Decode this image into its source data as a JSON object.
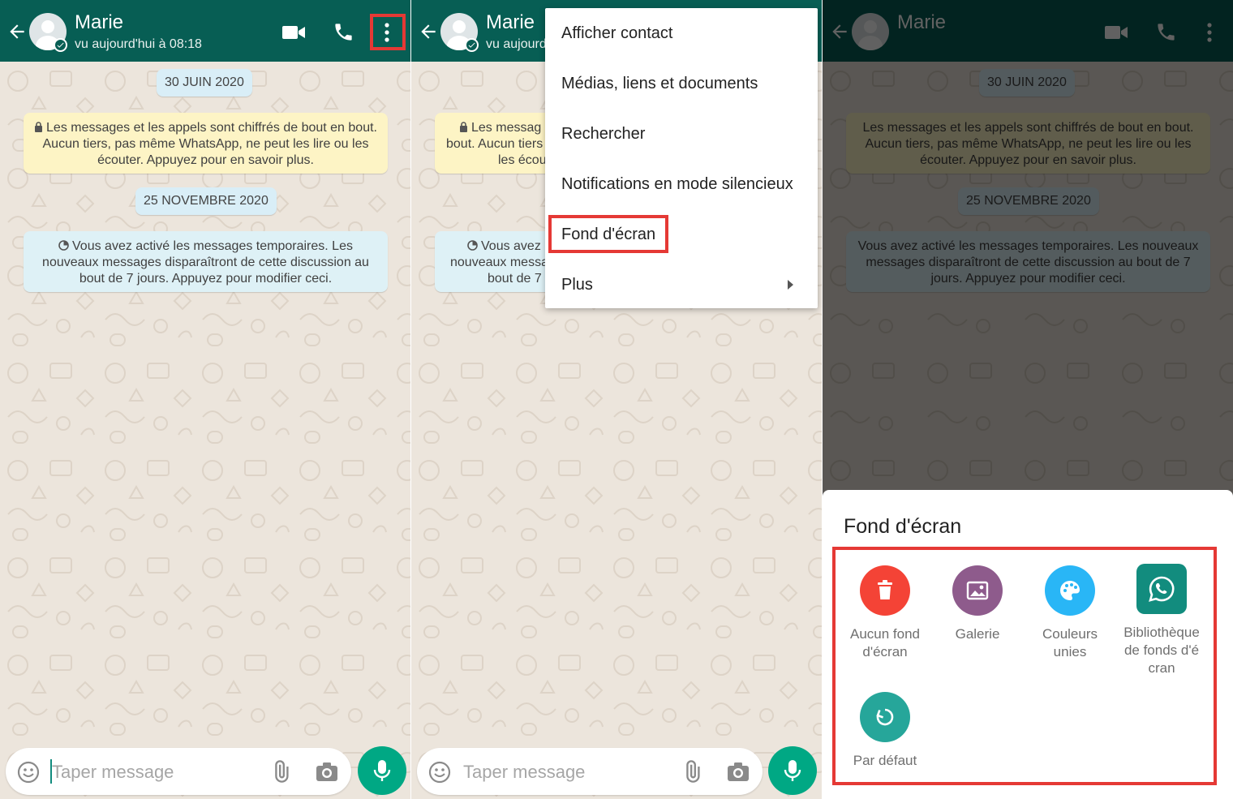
{
  "contact": {
    "name": "Marie",
    "last_seen": "vu aujourd'hui à 08:18",
    "last_seen_truncated": "vu aujourd"
  },
  "chat": {
    "date1": "30 JUIN 2020",
    "date2": "25 NOVEMBRE 2020",
    "encryption_notice": "Les messages et les appels sont chiffrés de bout en bout. Aucun tiers, pas même WhatsApp, ne peut les lire ou les écouter. Appuyez pour en savoir plus.",
    "encryption_notice_truncated": [
      "Les messag",
      "bout. Aucun tiers",
      "les écou"
    ],
    "temporary_notice": "Vous avez activé les messages temporaires. Les nouveaux messages disparaîtront de cette discussion au bout de 7 jours. Appuyez pour modifier ceci.",
    "temporary_notice_truncated": [
      "Vous avez",
      "nouveaux messa",
      "bout de 7"
    ]
  },
  "input": {
    "placeholder": "Taper message"
  },
  "menu": {
    "items": [
      {
        "label": "Afficher contact"
      },
      {
        "label": "Médias, liens et documents"
      },
      {
        "label": "Rechercher"
      },
      {
        "label": "Notifications en mode silencieux"
      },
      {
        "label": "Fond d'écran"
      },
      {
        "label": "Plus"
      }
    ]
  },
  "wallpaper_sheet": {
    "title": "Fond d'écran",
    "options": [
      {
        "label": "Aucun fond d'écran",
        "icon": "trash-icon",
        "color": "#f44336"
      },
      {
        "label": "Galerie",
        "icon": "image-icon",
        "color": "#8e5b8c"
      },
      {
        "label": "Couleurs unies",
        "icon": "palette-icon",
        "color": "#29b6f6"
      },
      {
        "label": "Bibliothèque de fonds d'écran",
        "icon": "whatsapp-icon",
        "color": "#128c7e"
      },
      {
        "label": "Par défaut",
        "icon": "reset-icon",
        "color": "#26a69a"
      }
    ]
  },
  "colors": {
    "header": "#075e54",
    "accent": "#00a884",
    "highlight": "#e53935"
  }
}
